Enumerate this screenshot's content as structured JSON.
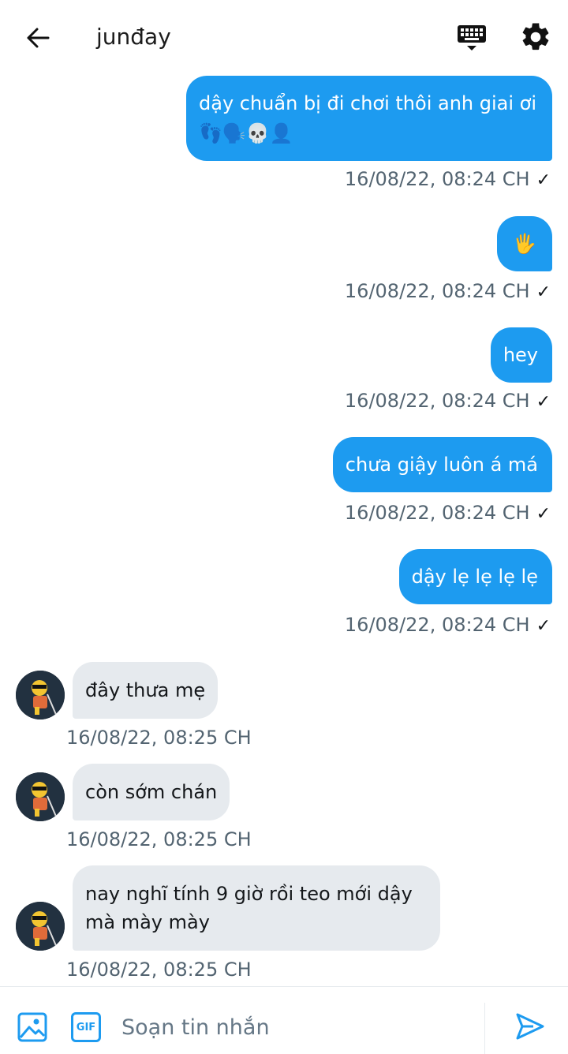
{
  "header": {
    "title": "junđay"
  },
  "colors": {
    "accent": "#1d9bf0",
    "incoming_bubble": "#e6eaee",
    "timestamp": "#536471"
  },
  "messages": {
    "out": [
      {
        "text": "dậy chuẩn bị đi chơi thôi anh giai ơi 👣🗣️💀👤",
        "time": "16/08/22,  08:24 CH",
        "status": "✓"
      },
      {
        "text": "🖐️",
        "time": "16/08/22,  08:24 CH",
        "status": "✓"
      },
      {
        "text": "hey",
        "time": "16/08/22,  08:24 CH",
        "status": "✓"
      },
      {
        "text": "chưa giậy luôn á má",
        "time": "16/08/22,  08:24 CH",
        "status": "✓"
      },
      {
        "text": "dậy lẹ lẹ lẹ lẹ",
        "time": "16/08/22,  08:24 CH",
        "status": "✓"
      }
    ],
    "in": [
      {
        "text": "đây thưa mẹ",
        "time": "16/08/22,  08:25 CH"
      },
      {
        "text": "còn sớm chán",
        "time": "16/08/22,  08:25 CH"
      },
      {
        "text": "nay nghĩ tính 9 giờ rồi teo mới dậy mà mày mày",
        "time": "16/08/22,  08:25 CH"
      }
    ]
  },
  "composer": {
    "placeholder": "Soạn tin nhắn",
    "gif_label": "GIF"
  },
  "icons": {
    "back": "arrow-left-icon",
    "keyboard": "keyboard-icon",
    "settings": "gear-icon",
    "image": "image-icon",
    "gif": "gif-icon",
    "send": "send-icon",
    "avatar": "avatar"
  }
}
